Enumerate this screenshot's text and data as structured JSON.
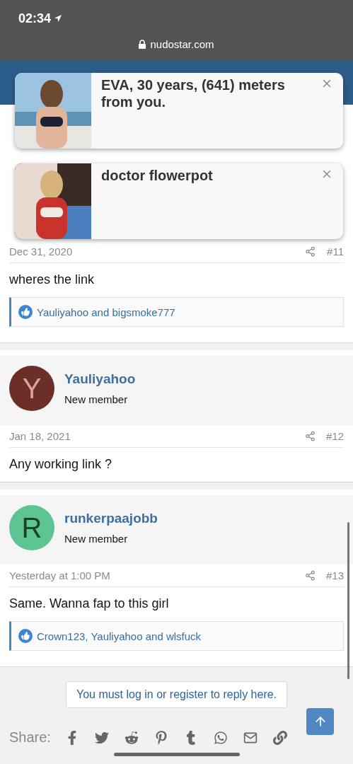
{
  "status_bar": {
    "time": "02:34"
  },
  "address_bar": {
    "url": "nudostar.com"
  },
  "ads": [
    {
      "title": "EVA, 30 years, (641) meters from you.",
      "kind": "picture"
    },
    {
      "title": "doctor flowerpot",
      "kind": "picture"
    }
  ],
  "posts": [
    {
      "date": "Dec 31, 2020",
      "number": "#11",
      "body": "wheres the link",
      "reactions": "Yauliyahoo and bigsmoke777"
    },
    {
      "author": {
        "initial": "Y",
        "name": "Yauliyahoo",
        "role": "New member",
        "color": "#6b2f28"
      },
      "date": "Jan 18, 2021",
      "number": "#12",
      "body": "Any working link ?"
    },
    {
      "author": {
        "initial": "R",
        "name": "runkerpaajobb",
        "role": "New member",
        "color": "#5cc490"
      },
      "date": "Yesterday at 1:00 PM",
      "number": "#13",
      "body": "Same. Wanna fap to this girl",
      "reactions": "Crown123, Yauliyahoo and wlsfuck"
    }
  ],
  "reply_notice": "You must log in or register to reply here.",
  "share": {
    "label": "Share:"
  }
}
